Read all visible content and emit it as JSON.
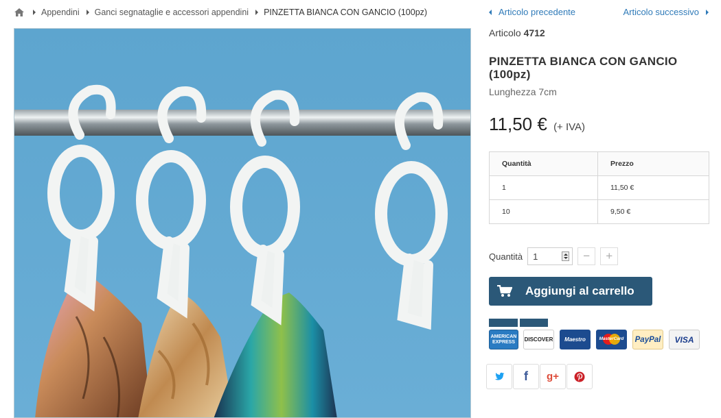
{
  "breadcrumb": {
    "items": [
      "Appendini",
      "Ganci segnataglie e accessori appendini",
      "PINZETTA BIANCA CON GANCIO (100pz)"
    ]
  },
  "nav": {
    "prev_label": "Articolo precedente",
    "next_label": "Articolo successivo"
  },
  "product": {
    "ref_label": "Articolo",
    "ref_number": "4712",
    "name": "PINZETTA BIANCA CON GANCIO (100pz)",
    "description": "Lunghezza 7cm",
    "price": "11,50 €",
    "vat_note": "(+ IVA)"
  },
  "price_table": {
    "headers": [
      "Quantità",
      "Prezzo"
    ],
    "rows": [
      [
        "1",
        "11,50 €"
      ],
      [
        "10",
        "9,50 €"
      ]
    ]
  },
  "quantity": {
    "label": "Quantità",
    "value": "1",
    "minus": "−",
    "plus": "+"
  },
  "cart": {
    "button_label": "Aggiungi al carrello",
    "icon": "cart-icon"
  },
  "payments": {
    "amex": "AMERICAN EXPRESS",
    "discover": "DISCOVER",
    "maestro": "Maestro",
    "mastercard": "MasterCard",
    "paypal": "PayPal",
    "visa": "VISA"
  },
  "share": {
    "twitter_icon": "twitter-icon",
    "facebook_glyph": "f",
    "gplus_glyph": "g+",
    "pinterest_icon": "pinterest-icon"
  },
  "colors": {
    "link": "#2f7ab8",
    "button": "#2b5878",
    "image_background": "#63a8cf"
  }
}
